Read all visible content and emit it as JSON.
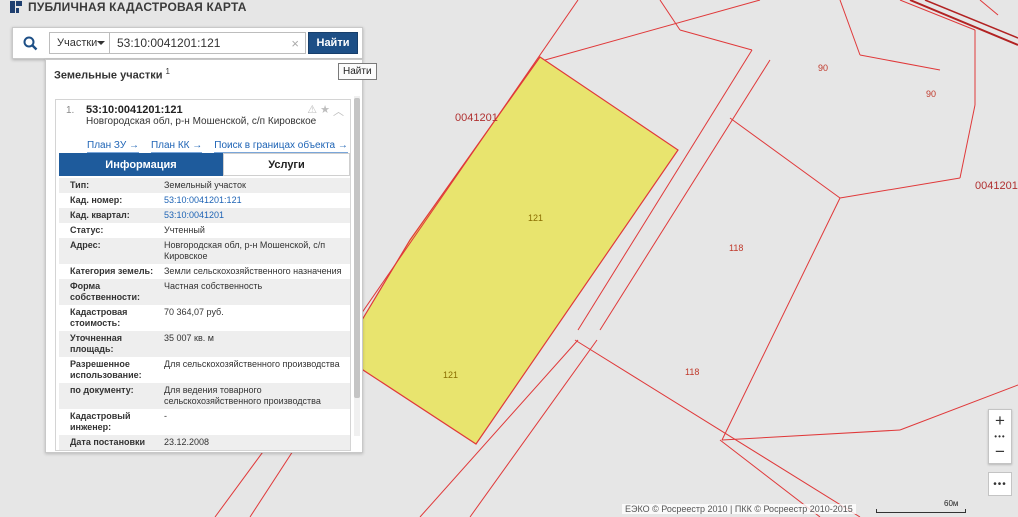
{
  "app": {
    "title": "ПУБЛИЧНАЯ КАДАСТРОВАЯ КАРТА"
  },
  "search": {
    "scope_label": "Участки",
    "query": "53:10:0041201:121",
    "find_label": "Найти",
    "tooltip": "Найти"
  },
  "panel": {
    "header": "Земельные участки",
    "count": "1",
    "result": {
      "index": "1.",
      "number": "53:10:0041201:121",
      "address": "Новгородская обл, р-н Мошенской, с/п Кировское",
      "links": [
        "План ЗУ →",
        "План КК →",
        "Поиск в границах объекта →"
      ],
      "tabs": [
        "Информация",
        "Услуги"
      ],
      "attributes": [
        {
          "label": "Тип:",
          "value": "Земельный участок"
        },
        {
          "label": "Кад. номер:",
          "value": "53:10:0041201:121"
        },
        {
          "label": "Кад. квартал:",
          "value": "53:10:0041201"
        },
        {
          "label": "Статус:",
          "value": "Учтенный"
        },
        {
          "label": "Адрес:",
          "value": "Новгородская обл, р-н Мошенской, с/п Кировское"
        },
        {
          "label": "Категория земель:",
          "value": "Земли сельскохозяйственного назначения"
        },
        {
          "label": "Форма собственности:",
          "value": "Частная собственность"
        },
        {
          "label": "Кадастровая стоимость:",
          "value": "70 364,07 руб."
        },
        {
          "label": "Уточненная площадь:",
          "value": "35 007 кв. м"
        },
        {
          "label": "Разрешенное использование:",
          "value": "Для сельскохозяйственного производства"
        },
        {
          "label": "по документу:",
          "value": "Для ведения товарного сельскохозяйственного производства"
        },
        {
          "label": "Кадастровый инженер:",
          "value": "-"
        },
        {
          "label": "Дата постановки на учет:",
          "value": "23.12.2008"
        }
      ]
    }
  },
  "map": {
    "labels": {
      "quarter_left": "0041201",
      "quarter_right": "0041201",
      "plot_121_a": "121",
      "plot_121_b": "121",
      "plot_118_a": "118",
      "plot_118_b": "118",
      "plot_90_a": "90",
      "plot_90_b": "90"
    },
    "colors": {
      "boundary": "#e0393a",
      "selected_fill": "#e8e46e",
      "background": "#e6e6e6"
    }
  },
  "controls": {
    "zoom_in": "+",
    "zoom_dots": "•••",
    "zoom_out": "−",
    "more": "•••"
  },
  "footer": {
    "copyright": "ЕЭКО © Росреестр 2010 | ПКК © Росреестр 2010-2015",
    "scale": "60м"
  }
}
